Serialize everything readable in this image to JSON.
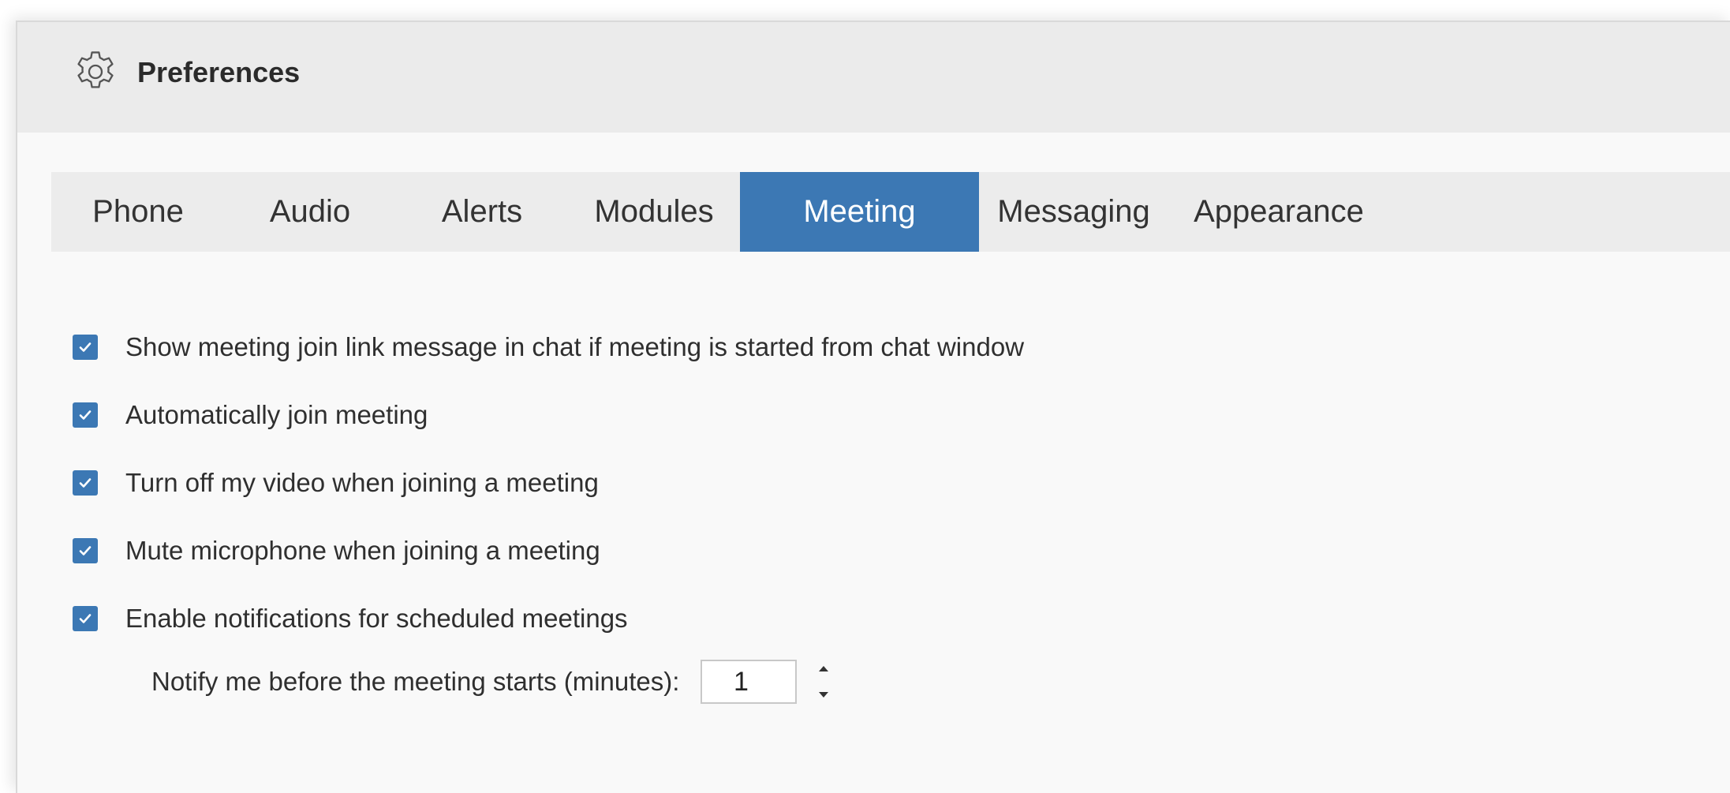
{
  "window": {
    "title": "Preferences",
    "title_icon": "gear-icon"
  },
  "tabs": [
    {
      "label": "Phone",
      "active": false
    },
    {
      "label": "Audio",
      "active": false
    },
    {
      "label": "Alerts",
      "active": false
    },
    {
      "label": "Modules",
      "active": false
    },
    {
      "label": "Meeting",
      "active": true
    },
    {
      "label": "Messaging",
      "active": false
    },
    {
      "label": "Appearance",
      "active": false
    }
  ],
  "meeting": {
    "options": [
      {
        "label": "Show meeting join link message in chat if meeting is started from chat window",
        "checked": true
      },
      {
        "label": "Automatically join meeting",
        "checked": true
      },
      {
        "label": "Turn off my video when joining a meeting",
        "checked": true
      },
      {
        "label": "Mute microphone when joining a meeting",
        "checked": true
      },
      {
        "label": "Enable notifications for scheduled meetings",
        "checked": true
      }
    ],
    "notify": {
      "label": "Notify me before the meeting starts (minutes):",
      "value": "1"
    }
  },
  "colors": {
    "accent": "#3c78b4",
    "titlebar_bg": "#ebebeb",
    "tabbar_bg": "#ececec",
    "content_bg": "#f9f9f9"
  }
}
